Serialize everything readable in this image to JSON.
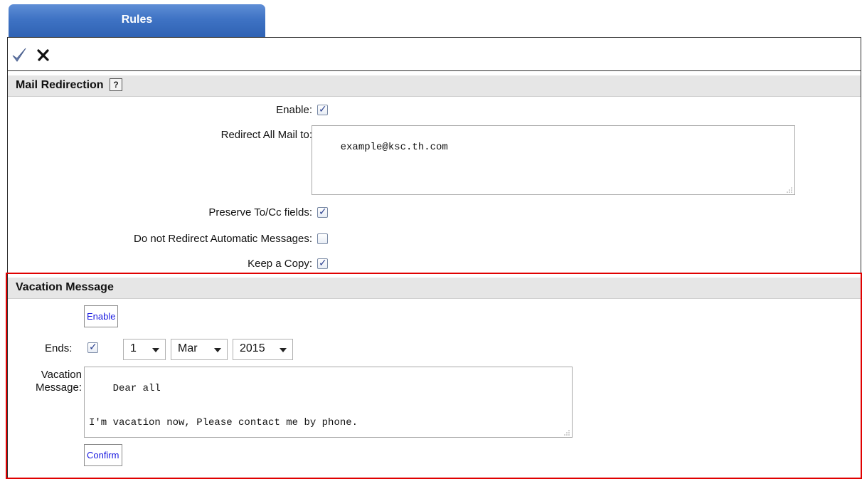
{
  "tab": {
    "label": "Rules"
  },
  "toolbar": {
    "ok_icon": "checkmark-icon",
    "cancel_icon": "close-icon"
  },
  "mail_redirection": {
    "title": "Mail Redirection",
    "help_label": "?",
    "enable_label": "Enable:",
    "enable_checked": true,
    "redirect_label": "Redirect All Mail to:",
    "redirect_value": "example@ksc.th.com",
    "preserve_label": "Preserve To/Cc fields:",
    "preserve_checked": true,
    "no_auto_label": "Do not Redirect Automatic Messages:",
    "no_auto_checked": false,
    "keep_copy_label": "Keep a Copy:",
    "keep_copy_checked": true
  },
  "vacation": {
    "title": "Vacation Message",
    "enable_button": "Enable",
    "ends_label": "Ends:",
    "ends_checked": true,
    "day": "1",
    "month": "Mar",
    "year": "2015",
    "message_label_line1": "Vacation",
    "message_label_line2": "Message:",
    "message_value": "Dear all\n\n\nI'm vacation now, Please contact me by phone.",
    "confirm_button": "Confirm"
  },
  "colors": {
    "tab_blue": "#3f73c4",
    "highlight_red": "#e00000",
    "link_blue": "#1a1ae0"
  }
}
